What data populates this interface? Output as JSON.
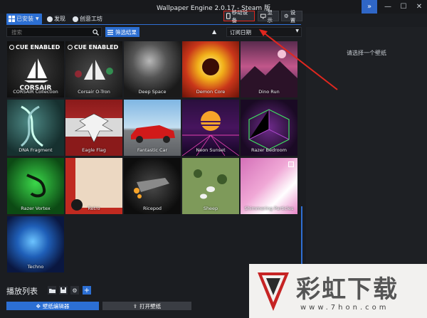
{
  "window": {
    "title": "Wallpaper Engine 2.0.17 - Steam 版"
  },
  "tabs": {
    "installed": "已安装",
    "discover": "发现",
    "workshop": "创意工坊"
  },
  "right_buttons": {
    "mobile": "移动设备",
    "display": "显示",
    "settings": "设置"
  },
  "search": {
    "placeholder": "搜索"
  },
  "filter": {
    "label": "筛选结果"
  },
  "sort": {
    "value": "订阅日期"
  },
  "wallpapers": [
    {
      "title": "CORSAIR Collection",
      "badge": "CUE ENABLED",
      "logo": "CORSAIR"
    },
    {
      "title": "Corsair O-Tron",
      "badge": "CUE ENABLED"
    },
    {
      "title": "Deep Space"
    },
    {
      "title": "Demon Core"
    },
    {
      "title": "Dino Run"
    },
    {
      "title": "DNA Fragment"
    },
    {
      "title": "Eagle Flag"
    },
    {
      "title": "Fantastic Car"
    },
    {
      "title": "Neon Sunset"
    },
    {
      "title": "Razer Bedroom"
    },
    {
      "title": "Razer Vortex"
    },
    {
      "title": "Retro"
    },
    {
      "title": "Ricepod"
    },
    {
      "title": "Sheep"
    },
    {
      "title": "Shimmering Particles"
    },
    {
      "title": "Techno"
    }
  ],
  "details": {
    "empty_text": "请选择一个壁纸"
  },
  "playlist": {
    "title": "播放列表"
  },
  "bottom": {
    "editor": "壁纸编辑器",
    "open": "打开壁纸"
  },
  "watermark": {
    "text": "彩虹下载",
    "url": "www.7hon.com"
  },
  "colors": {
    "accent": "#2c6fd3",
    "highlight": "#e0271f"
  }
}
